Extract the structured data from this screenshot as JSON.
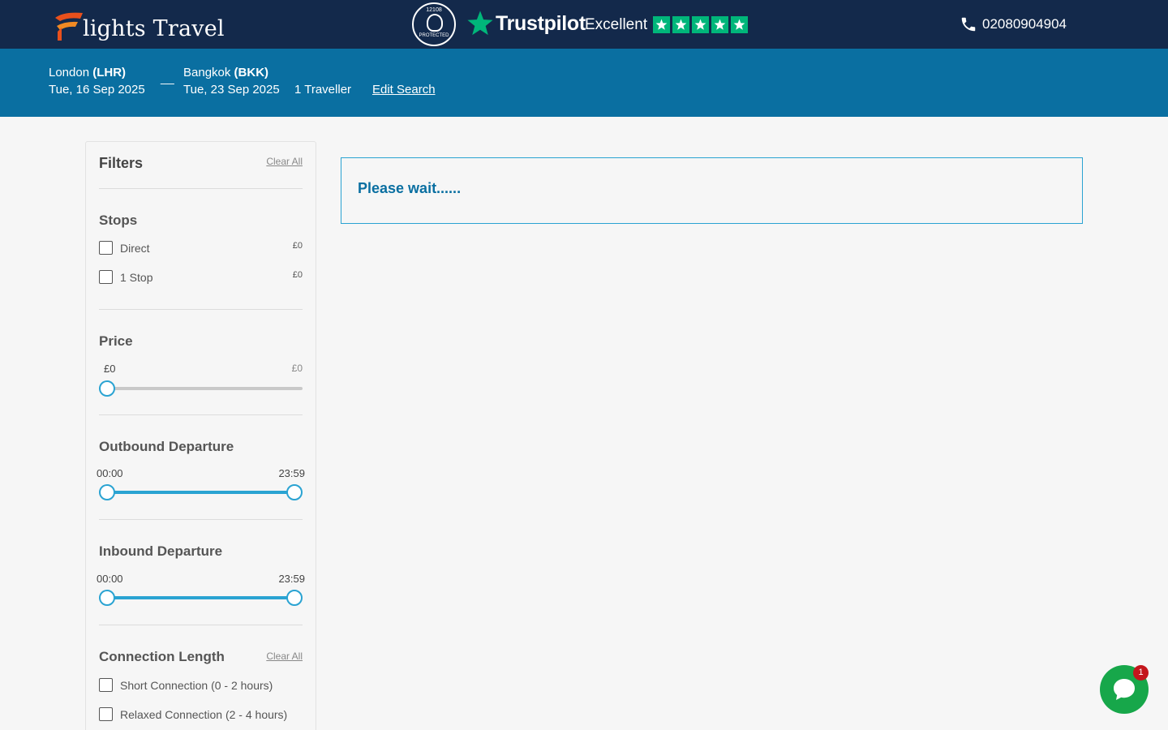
{
  "header": {
    "logo_text": "lights Travel",
    "atol": {
      "number": "12108",
      "label": "PROTECTED"
    },
    "trustpilot": {
      "name": "Trustpilot",
      "rating_label": "Excellent",
      "stars": 5,
      "star_color": "#00b67a"
    },
    "phone": "02080904904"
  },
  "search": {
    "origin_city": "London",
    "origin_code": "(LHR)",
    "depart_date": "Tue, 16 Sep 2025",
    "dash": "__",
    "dest_city": "Bangkok",
    "dest_code": "(BKK)",
    "return_date": "Tue, 23 Sep 2025",
    "travellers": "1 Traveller",
    "edit_label": "Edit Search"
  },
  "filters": {
    "title": "Filters",
    "clear_all": "Clear All",
    "stops": {
      "title": "Stops",
      "options": [
        {
          "label": "Direct",
          "price": "£0"
        },
        {
          "label": "1 Stop",
          "price": "£0"
        }
      ]
    },
    "price": {
      "title": "Price",
      "min": "£0",
      "max": "£0"
    },
    "outbound": {
      "title": "Outbound Departure",
      "min": "00:00",
      "max": "23:59"
    },
    "inbound": {
      "title": "Inbound Departure",
      "min": "00:00",
      "max": "23:59"
    },
    "connection": {
      "title": "Connection Length",
      "clear_all": "Clear All",
      "options": [
        {
          "label": "Short Connection (0 - 2 hours)"
        },
        {
          "label": "Relaxed Connection (2 - 4 hours)"
        }
      ]
    }
  },
  "main": {
    "loading_text": "Please wait......"
  },
  "chat": {
    "badge": "1",
    "color": "#17a74a"
  },
  "colors": {
    "header": "#13294b",
    "search_bar": "#0a6fa1",
    "accent": "#2aa3d2"
  }
}
